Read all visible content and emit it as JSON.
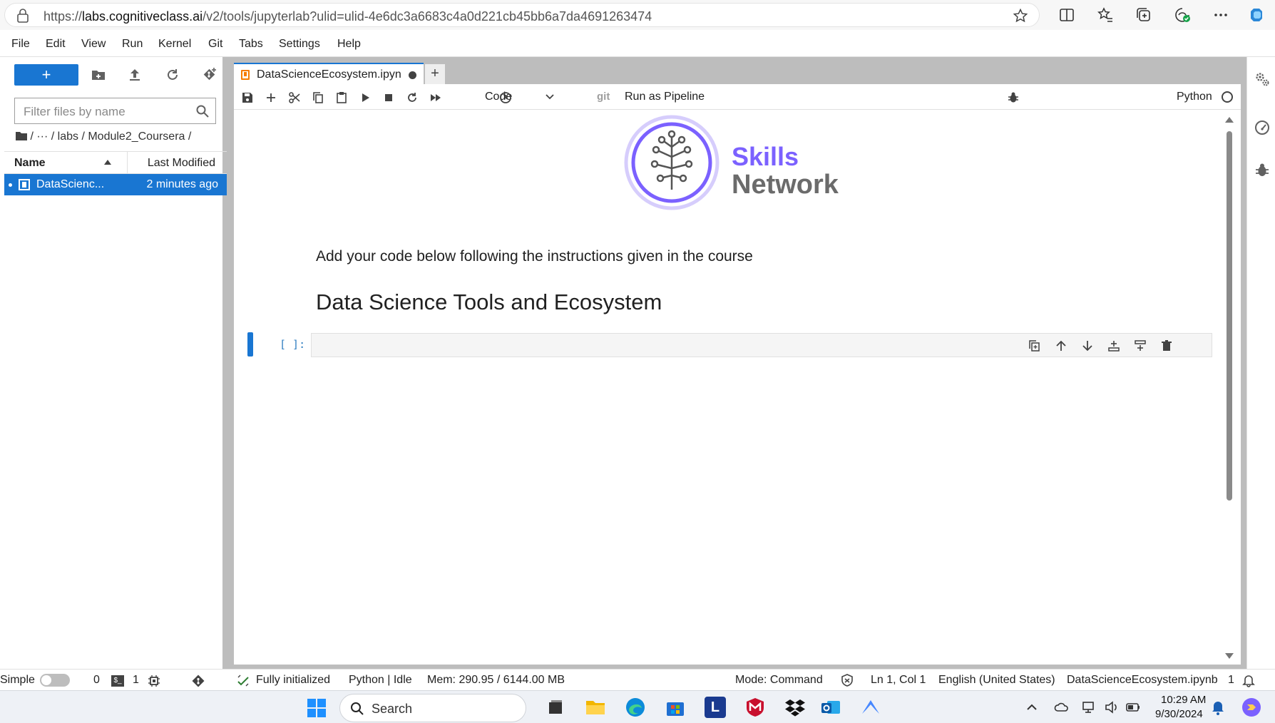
{
  "browser": {
    "url_prefix": "https://",
    "url_host": "labs.cognitiveclass.ai",
    "url_path": "/v2/tools/jupyterlab?ulid=ulid-4e6dc3a6683c4a0d221cb45bb6a7da4691263474"
  },
  "menu": [
    "File",
    "Edit",
    "View",
    "Run",
    "Kernel",
    "Git",
    "Tabs",
    "Settings",
    "Help"
  ],
  "sidebar": {
    "new_label": "+",
    "filter_placeholder": "Filter files by name",
    "breadcrumb": "/   ···   / labs / Module2_Coursera /",
    "col_name": "Name",
    "col_modified": "Last Modified",
    "files": [
      {
        "name": "DataScienc...",
        "modified": "2 minutes ago"
      }
    ]
  },
  "tab": {
    "title": "DataScienceEcosystem.ipyn",
    "add": "+"
  },
  "toolbar": {
    "cell_type": "Code",
    "git": "git",
    "pipeline": "Run as Pipeline",
    "kernel": "Python"
  },
  "notebook": {
    "logo_word1": "Skills",
    "logo_word2": "Network",
    "intro": "Add your code below following the instructions given in the course",
    "heading": "Data Science Tools and Ecosystem",
    "prompt": "[ ]:"
  },
  "status": {
    "mode_label": "Simple",
    "terminals": "0",
    "terminal_glyph": "$_",
    "kernels": "1",
    "init": "Fully initialized",
    "kernel_state": "Python | Idle",
    "mem": "Mem: 290.95 / 6144.00 MB",
    "mode": "Mode: Command",
    "cursor": "Ln 1, Col 1",
    "lang": "English (United States)",
    "file": "DataScienceEcosystem.ipynb",
    "notif": "1"
  },
  "taskbar": {
    "search_placeholder": "Search",
    "app_letter": "L",
    "time": "10:29 AM",
    "date": "9/30/2024"
  },
  "colors": {
    "accent": "#1976d2",
    "logo_purple": "#7b61ff",
    "prompt_blue": "#307fc1"
  }
}
